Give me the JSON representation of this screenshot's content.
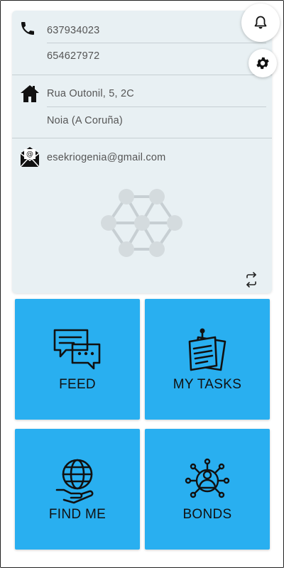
{
  "contact": {
    "phone_1": "637934023",
    "phone_2": "654627972",
    "address_line_1": "Rua Outonil, 5, 2C",
    "address_line_2": "Noia (A Coruña)",
    "email": "esekriogenia@gmail.com"
  },
  "icons": {
    "phone": "phone-icon",
    "home": "home-icon",
    "email": "email-icon",
    "notifications": "bell-icon",
    "settings": "gear-icon",
    "refresh": "swap-icon",
    "watermark": "network-logo"
  },
  "tiles": [
    {
      "label": "FEED",
      "icon": "chat-bubbles-icon"
    },
    {
      "label": "MY TASKS",
      "icon": "notes-icon"
    },
    {
      "label": "FIND ME",
      "icon": "globe-hand-icon"
    },
    {
      "label": "BONDS",
      "icon": "people-network-icon"
    }
  ],
  "colors": {
    "tile_background": "#29aff0",
    "card_background": "#e8f0f3"
  }
}
